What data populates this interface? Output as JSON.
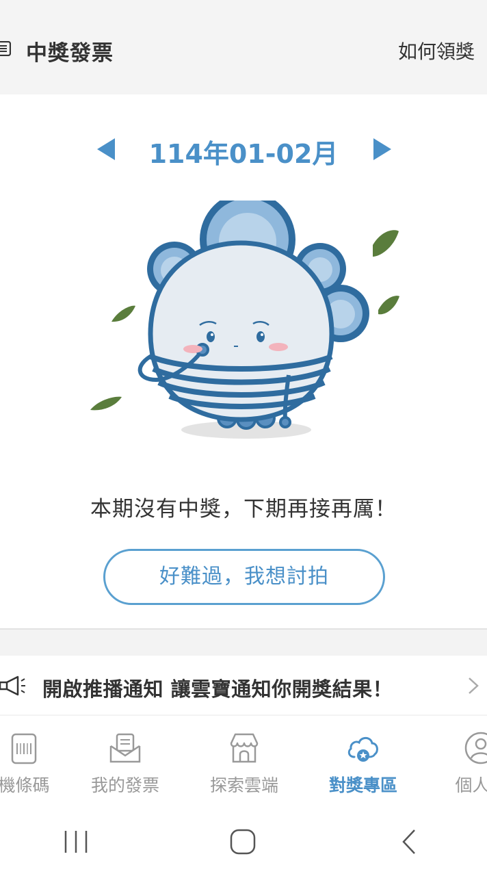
{
  "header": {
    "title": "中獎發票",
    "how_to_claim": "如何領獎"
  },
  "period": {
    "label": "114年01-02月"
  },
  "result": {
    "message": "本期沒有中獎，下期再接再厲！",
    "button_label": "好難過，我想討拍"
  },
  "notification": {
    "text": "開啟推播通知 讓雲寶通知你開獎結果！"
  },
  "tabs": [
    {
      "label": "機條碼",
      "icon": "barcode-icon",
      "active": false
    },
    {
      "label": "我的發票",
      "icon": "invoice-icon",
      "active": false
    },
    {
      "label": "探索雲端",
      "icon": "store-icon",
      "active": false
    },
    {
      "label": "對獎專區",
      "icon": "cloud-star-icon",
      "active": true
    },
    {
      "label": "個人設",
      "icon": "profile-icon",
      "active": false
    }
  ],
  "colors": {
    "accent": "#4a90c8",
    "text": "#333333",
    "inactive": "#999999",
    "leaf": "#5a7d3c"
  }
}
